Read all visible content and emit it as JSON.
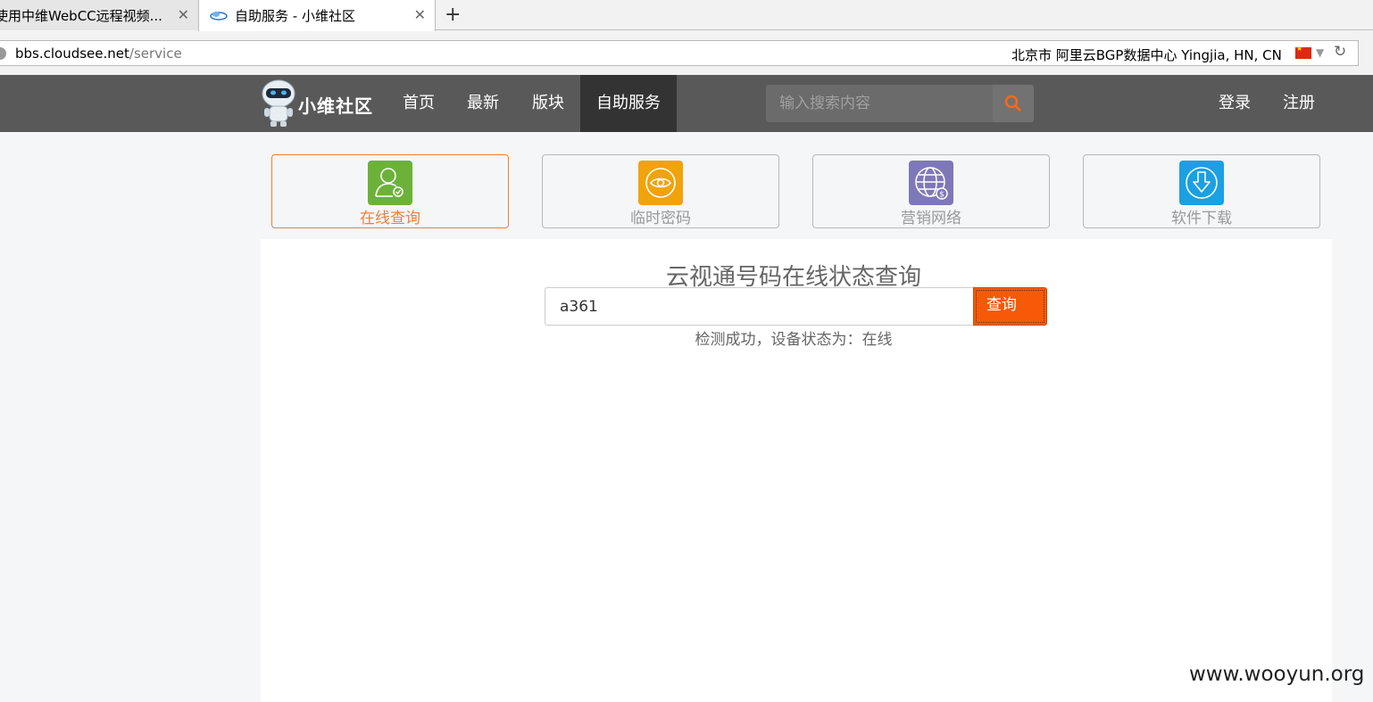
{
  "browser": {
    "tabs": [
      {
        "title": "使用中维WebCC远程视频..."
      },
      {
        "title": "自助服务 - 小维社区"
      }
    ],
    "close_glyph": "✕",
    "new_tab_glyph": "+",
    "url": {
      "host": "bbs.cloudsee.net",
      "path": "/service"
    },
    "geo_info": "北京市 阿里云BGP数据中心   Yingjia, HN, CN"
  },
  "site": {
    "logo_text": "小维社区",
    "nav": [
      "首页",
      "最新",
      "版块",
      "自助服务"
    ],
    "active_nav": "自助服务",
    "search_placeholder": "输入搜索内容",
    "login": "登录",
    "register": "注册"
  },
  "service_cards": [
    {
      "label": "在线查询",
      "color": "#6cb23a",
      "icon": "user-check-icon",
      "active": true
    },
    {
      "label": "临时密码",
      "color": "#f0a30a",
      "icon": "eye-icon",
      "active": false
    },
    {
      "label": "营销网络",
      "color": "#7f78b8",
      "icon": "globe-dollar-icon",
      "active": false
    },
    {
      "label": "软件下载",
      "color": "#1aa0e3",
      "icon": "download-icon",
      "active": false
    }
  ],
  "query": {
    "title": "云视通号码在线状态查询",
    "input_value": "a361",
    "button_label": "查询",
    "result_text": "检测成功，设备状态为：在线"
  },
  "watermark": "www.wooyun.org",
  "colors": {
    "accent": "#f65a06",
    "nav_bg": "#595959",
    "nav_active": "#333333"
  }
}
